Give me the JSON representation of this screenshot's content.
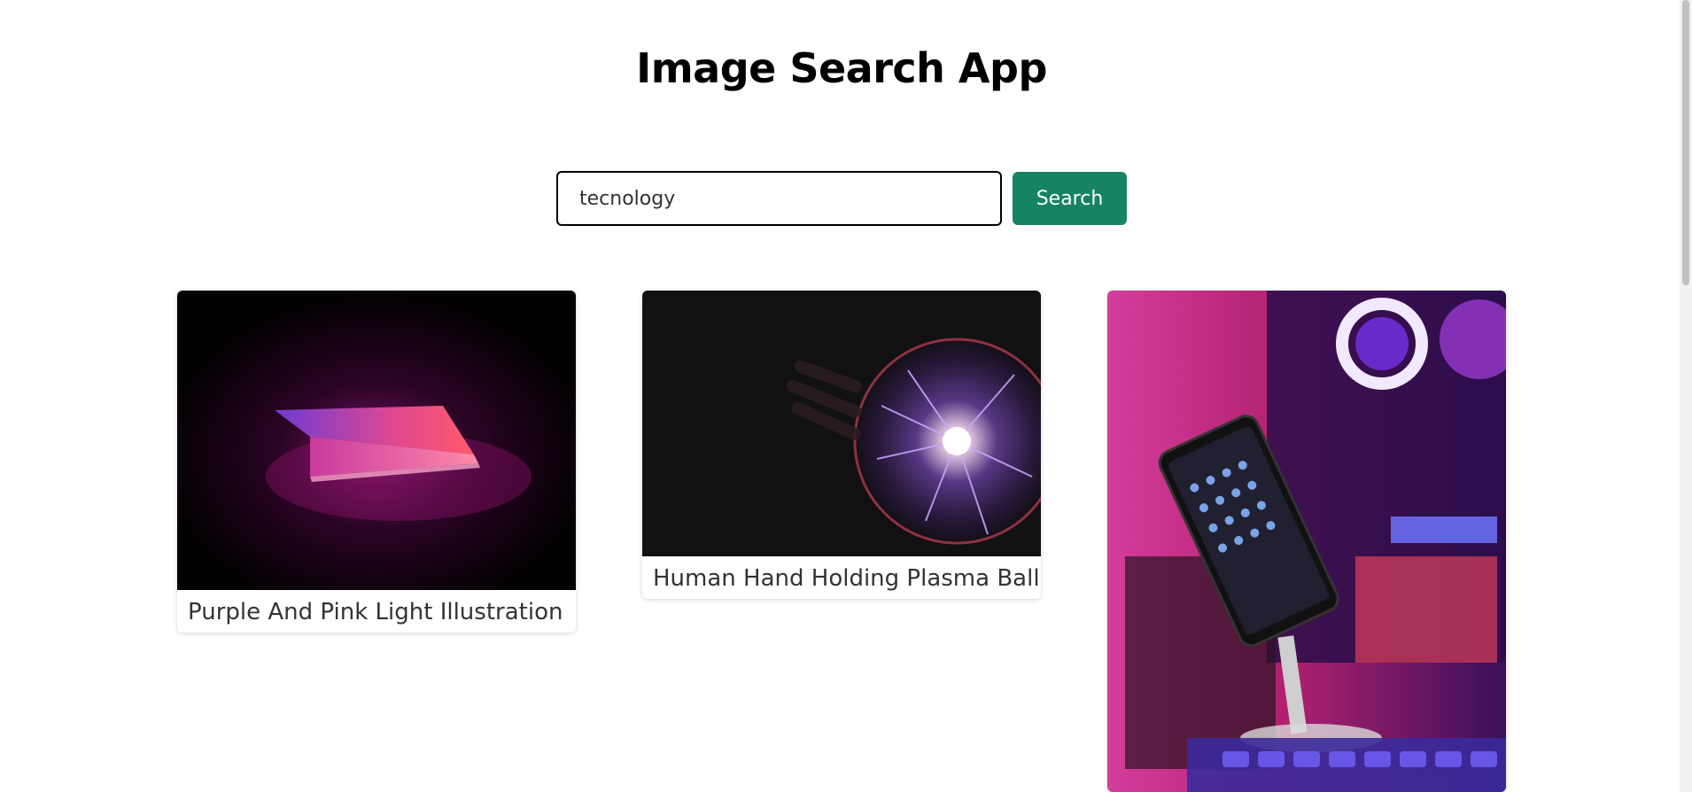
{
  "header": {
    "title": "Image Search App"
  },
  "search": {
    "value": "tecnology",
    "button_label": "Search"
  },
  "results": [
    {
      "caption": "Purple And Pink Light Illustration",
      "image_icon": "laptop-glow-image"
    },
    {
      "caption": "Human Hand Holding Plasma Ball",
      "image_icon": "plasma-ball-image"
    },
    {
      "caption": "",
      "image_icon": "smartphone-pc-setup-image"
    }
  ],
  "colors": {
    "accent": "#168363",
    "text": "#333333"
  }
}
